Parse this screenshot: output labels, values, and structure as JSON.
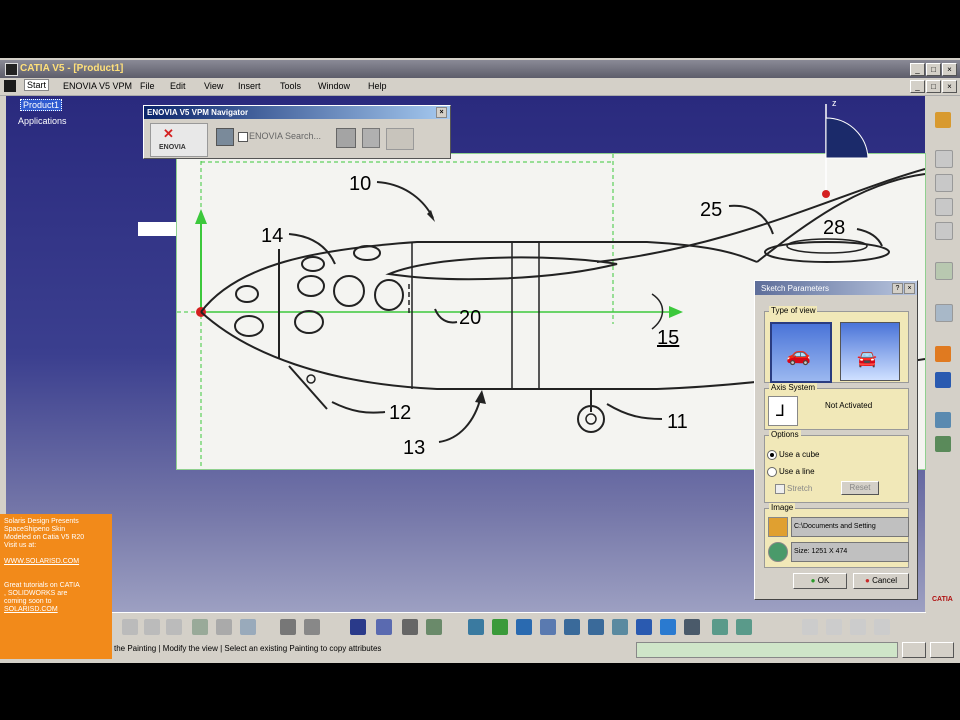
{
  "window": {
    "title": "CATIA V5 - [Product1]"
  },
  "menubar": {
    "items": [
      "Start",
      "ENOVIA V5 VPM",
      "File",
      "Edit",
      "View",
      "Insert",
      "Tools",
      "Window",
      "Help"
    ]
  },
  "tree": {
    "root": "Product1",
    "child": "Applications"
  },
  "nav_panel": {
    "title": "ENOVIA V5 VPM Navigator",
    "logo": "ENOVIA",
    "search_label": "ENOVIA Search..."
  },
  "drawing": {
    "labels": [
      "10",
      "14",
      "20",
      "15",
      "12",
      "13",
      "11",
      "25",
      "28"
    ]
  },
  "compass": {
    "axis": "z"
  },
  "dialog": {
    "title": "Sketch Parameters",
    "type_of_view": "Type of view",
    "axis_system": "Axis System",
    "axis_status": "Not Activated",
    "options": "Options",
    "use_cube": "Use a cube",
    "use_line": "Use a line",
    "stretch": "Stretch",
    "reset": "Reset",
    "image": "Image",
    "image_path": "C:\\Documents and Setting",
    "image_size": "Size: 1251 X 474",
    "ok": "OK",
    "cancel": "Cancel"
  },
  "promo": {
    "lines": [
      "Solaris Design Presents",
      "SpaceShipeno Skin",
      "Modeled on Catia V5 R20",
      "Visit us at:",
      "",
      "WWW.SOLARISD.COM",
      "",
      "",
      "Great tutorials on CATIA",
      ", SOLIDWORKS are",
      "coming soon to",
      "SOLARISD.COM"
    ]
  },
  "status": {
    "text": "the Painting | Modify the view | Select an existing Painting to copy attributes"
  },
  "right_toolbar_label": "CATIA",
  "colors": {
    "viewport_top": "#2a2a7e",
    "promo_orange": "#f28a1a",
    "accent_green": "#3cc83c",
    "origin_red": "#d42020"
  }
}
